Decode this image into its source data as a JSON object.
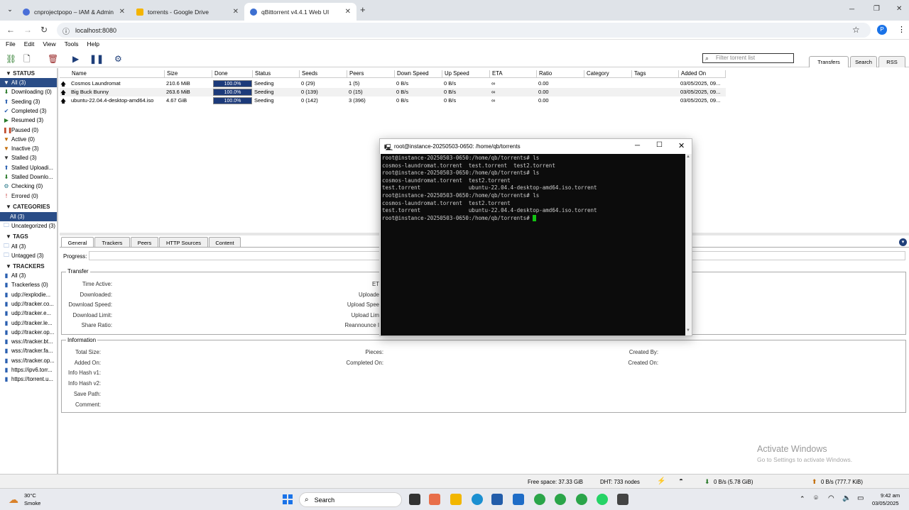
{
  "browser": {
    "tabs": [
      {
        "title": "cnprojectpopo – IAM & Admin",
        "color": "#4a6fd8"
      },
      {
        "title": "torrents - Google Drive",
        "color": "#f4b400"
      },
      {
        "title": "qBittorrent v4.4.1 Web UI",
        "color": "#3d6fd1"
      }
    ],
    "new_tab": "+",
    "url": "localhost:8080",
    "profile_initial": "P"
  },
  "menu": [
    "File",
    "Edit",
    "View",
    "Tools",
    "Help"
  ],
  "filter": {
    "placeholder": "Filter torrent list"
  },
  "view_tabs": [
    "Transfers",
    "Search",
    "RSS"
  ],
  "sidebar": {
    "status_header": "STATUS",
    "status": [
      {
        "label": "All (3)",
        "icon": "filter-icon"
      },
      {
        "label": "Downloading (0)",
        "icon": "download-arrow-icon"
      },
      {
        "label": "Seeding (3)",
        "icon": "upload-arrow-icon"
      },
      {
        "label": "Completed (3)",
        "icon": "check-icon"
      },
      {
        "label": "Resumed (3)",
        "icon": "play-icon"
      },
      {
        "label": "Paused (0)",
        "icon": "pause-icon"
      },
      {
        "label": "Active (0)",
        "icon": "filter-icon"
      },
      {
        "label": "Inactive (3)",
        "icon": "filter-icon"
      },
      {
        "label": "Stalled (3)",
        "icon": "stalled-icon"
      },
      {
        "label": "Stalled Uploadi...",
        "icon": "upload-arrow-icon"
      },
      {
        "label": "Stalled Downlo...",
        "icon": "download-arrow-icon"
      },
      {
        "label": "Checking (0)",
        "icon": "gear-icon"
      },
      {
        "label": "Errored (0)",
        "icon": "error-icon"
      }
    ],
    "categories_header": "CATEGORIES",
    "categories": [
      "All (3)",
      "Uncategorized (3)"
    ],
    "tags_header": "TAGS",
    "tags": [
      "All (3)",
      "Untagged (3)"
    ],
    "trackers_header": "TRACKERS",
    "trackers": [
      "All (3)",
      "Trackerless (0)",
      "udp://explodie...",
      "udp://tracker.co...",
      "udp://tracker.e...",
      "udp://tracker.le...",
      "udp://tracker.op...",
      "wss://tracker.bt...",
      "wss://tracker.fa...",
      "wss://tracker.op...",
      "https://ipv6.torr...",
      "https://torrent.u..."
    ]
  },
  "table": {
    "columns": [
      "Name",
      "Size",
      "Done",
      "Status",
      "Seeds",
      "Peers",
      "Down Speed",
      "Up Speed",
      "ETA",
      "Ratio",
      "Category",
      "Tags",
      "Added On"
    ],
    "rows": [
      {
        "name": "Cosmos Laundromat",
        "size": "210.6 MiB",
        "done": "100.0%",
        "progress": 1.0,
        "status": "Seeding",
        "seeds": "0 (29)",
        "peers": "1 (5)",
        "down": "0 B/s",
        "up": "0 B/s",
        "eta": "∞",
        "ratio": "0.00",
        "category": "",
        "tags": "",
        "added": "03/05/2025, 09..."
      },
      {
        "name": "Big Buck Bunny",
        "size": "263.6 MiB",
        "done": "100.0%",
        "progress": 1.0,
        "status": "Seeding",
        "seeds": "0 (139)",
        "peers": "0 (15)",
        "down": "0 B/s",
        "up": "0 B/s",
        "eta": "∞",
        "ratio": "0.00",
        "category": "",
        "tags": "",
        "added": "03/05/2025, 09..."
      },
      {
        "name": "ubuntu-22.04.4-desktop-amd64.iso",
        "size": "4.67 GiB",
        "done": "100.0%",
        "progress": 1.0,
        "status": "Seeding",
        "seeds": "0 (142)",
        "peers": "3 (396)",
        "down": "0 B/s",
        "up": "0 B/s",
        "eta": "∞",
        "ratio": "0.00",
        "category": "",
        "tags": "",
        "added": "03/05/2025, 09..."
      }
    ]
  },
  "details": {
    "tabs": [
      "General",
      "Trackers",
      "Peers",
      "HTTP Sources",
      "Content"
    ],
    "progress_label": "Progress:",
    "transfer_legend": "Transfer",
    "transfer_left": [
      "Time Active:",
      "Downloaded:",
      "Download Speed:",
      "Download Limit:",
      "Share Ratio:"
    ],
    "transfer_mid": [
      "ET",
      "Uploade",
      "Upload Spee",
      "Upload Lim",
      "Reannounce I"
    ],
    "info_legend": "Information",
    "info_left": [
      "Total Size:",
      "Added On:",
      "Info Hash v1:",
      "Info Hash v2:",
      "Save Path:",
      "Comment:"
    ],
    "info_mid": [
      "Pieces:",
      "Completed On:"
    ],
    "info_right": [
      "Created By:",
      "Created On:"
    ]
  },
  "terminal": {
    "title": "root@instance-20250503-0650: /home/qb/torrents",
    "lines": [
      "root@instance-20250503-0650:/home/qb/torrents# ls",
      "cosmos-laundromat.torrent  test.torrent  test2.torrent",
      "root@instance-20250503-0650:/home/qb/torrents# ls",
      "cosmos-laundromat.torrent  test2.torrent",
      "test.torrent               ubuntu-22.04.4-desktop-amd64.iso.torrent",
      "root@instance-20250503-0650:/home/qb/torrents# ls",
      "cosmos-laundromat.torrent  test2.torrent",
      "test.torrent               ubuntu-22.04.4-desktop-amd64.iso.torrent"
    ],
    "prompt": "root@instance-20250503-0650:/home/qb/torrents# "
  },
  "statusbar": {
    "free_space": "Free space: 37.33 GiB",
    "dht": "DHT: 733 nodes",
    "download": "0 B/s (5.78 GiB)",
    "upload": "0 B/s (777.7 KiB)"
  },
  "watermark": {
    "line1": "Activate Windows",
    "line2": "Go to Settings to activate Windows."
  },
  "taskbar": {
    "weather_temp": "30°C",
    "weather_desc": "Smoke",
    "search": "Search",
    "time": "9:42 am",
    "date": "03/05/2025"
  }
}
